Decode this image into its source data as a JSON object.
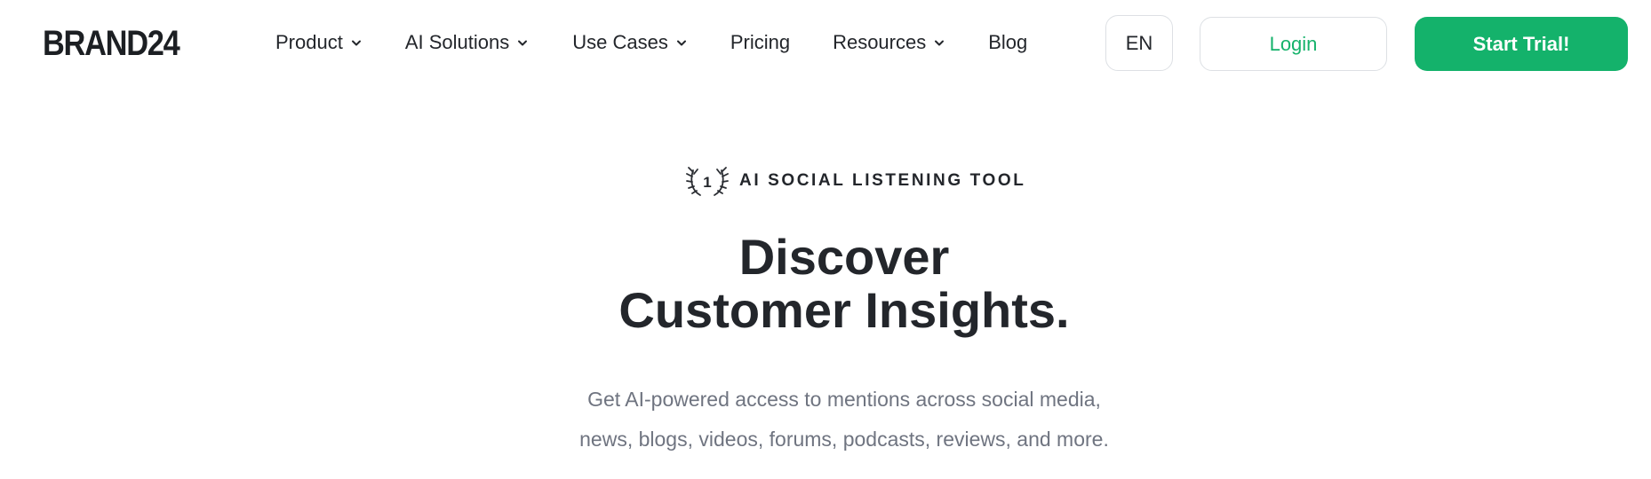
{
  "header": {
    "logo": "BRAND24",
    "nav": [
      {
        "label": "Product",
        "has_dropdown": true
      },
      {
        "label": "AI Solutions",
        "has_dropdown": true
      },
      {
        "label": "Use Cases",
        "has_dropdown": true
      },
      {
        "label": "Pricing",
        "has_dropdown": false
      },
      {
        "label": "Resources",
        "has_dropdown": true
      },
      {
        "label": "Blog",
        "has_dropdown": false
      }
    ],
    "language": "EN",
    "login_label": "Login",
    "trial_label": "Start Trial!"
  },
  "hero": {
    "badge_number": "1",
    "badge_text": "AI SOCIAL LISTENING TOOL",
    "title_line1": "Discover",
    "title_line2": "Customer Insights.",
    "subtitle_line1": "Get AI-powered access to mentions across social media,",
    "subtitle_line2": "news, blogs, videos, forums, podcasts, reviews, and more."
  },
  "colors": {
    "accent_green": "#14b26b",
    "text_dark": "#23262b",
    "text_muted": "#6f7480",
    "border": "#dde0e4"
  },
  "icons": {
    "dropdown": "chevron-down-icon",
    "badge": "laurel-wreath-icon"
  }
}
